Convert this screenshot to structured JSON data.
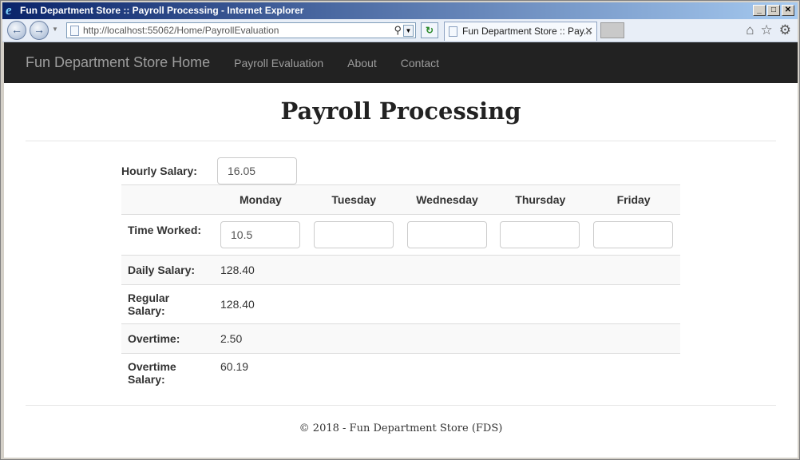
{
  "window": {
    "title": "Fun Department Store :: Payroll Processing - Internet Explorer",
    "controls": [
      "_",
      "□",
      "✕"
    ]
  },
  "browser": {
    "address": "http://localhost:55062/Home/PayrollEvaluation",
    "tab_title": "Fun Department Store :: Pay...",
    "tab_close": "✕",
    "back": "←",
    "forward": "→",
    "refresh": "↻",
    "search_glyph": "⚲",
    "dropdown_glyph": "▼",
    "home": "⌂",
    "favorites": "☆",
    "tools": "⚙",
    "ie_logo": "e"
  },
  "nav": {
    "brand": "Fun Department Store Home",
    "links": [
      "Payroll Evaluation",
      "About",
      "Contact"
    ]
  },
  "page": {
    "title": "Payroll Processing"
  },
  "form": {
    "hourly_label": "Hourly Salary:",
    "hourly_value": "16.05",
    "days": [
      "Monday",
      "Tuesday",
      "Wednesday",
      "Thursday",
      "Friday"
    ],
    "time_worked_label": "Time Worked:",
    "time_worked": [
      "10.5",
      "",
      "",
      "",
      ""
    ],
    "rows": [
      {
        "label": "Daily Salary:",
        "value": "128.40"
      },
      {
        "label": "Regular Salary:",
        "value": "128.40"
      },
      {
        "label": "Overtime:",
        "value": "2.50"
      },
      {
        "label": "Overtime Salary:",
        "value": "60.19"
      }
    ]
  },
  "footer": {
    "text": "© 2018 - Fun Department Store (FDS)"
  }
}
